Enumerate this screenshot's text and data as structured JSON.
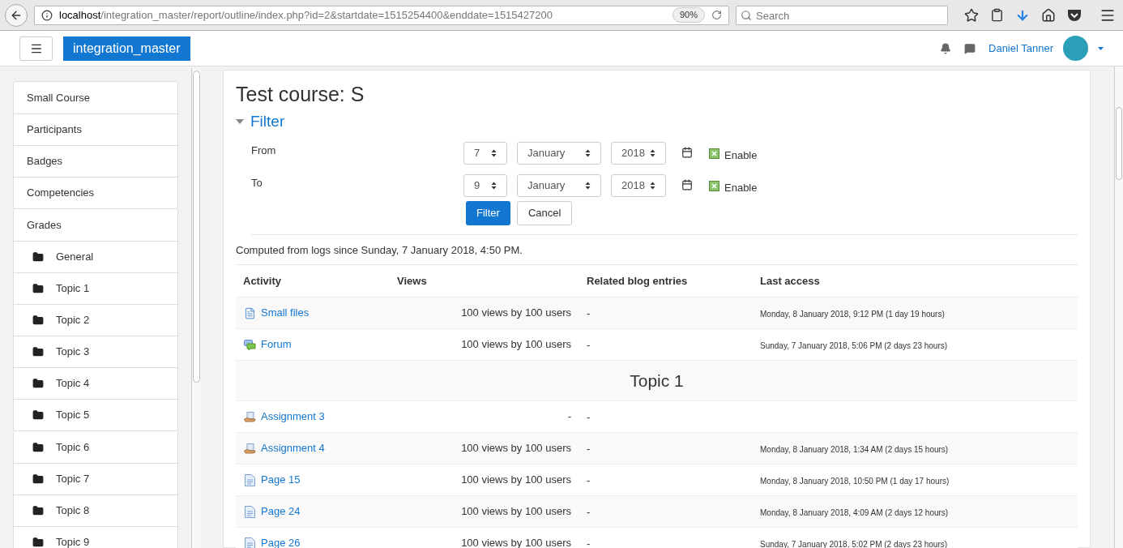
{
  "browser": {
    "url_host": "localhost",
    "url_path": "/integration_master/report/outline/index.php?id=2&startdate=1515254400&enddate=1515427200",
    "zoom": "90%",
    "search_placeholder": "Search"
  },
  "navbar": {
    "site_name": "integration_master",
    "user_name": "Daniel Tanner"
  },
  "sidebar": {
    "groups": [
      [
        {
          "label": "Small Course",
          "kind": "link"
        },
        {
          "label": "Participants",
          "kind": "link"
        },
        {
          "label": "Badges",
          "kind": "link"
        },
        {
          "label": "Competencies",
          "kind": "link"
        }
      ],
      [
        {
          "label": "Grades",
          "kind": "link"
        },
        {
          "label": "General",
          "kind": "folder"
        },
        {
          "label": "Topic 1",
          "kind": "folder"
        },
        {
          "label": "Topic 2",
          "kind": "folder"
        },
        {
          "label": "Topic 3",
          "kind": "folder"
        },
        {
          "label": "Topic 4",
          "kind": "folder"
        },
        {
          "label": "Topic 5",
          "kind": "folder"
        }
      ],
      [
        {
          "label": "Topic 6",
          "kind": "folder"
        },
        {
          "label": "Topic 7",
          "kind": "folder"
        },
        {
          "label": "Topic 8",
          "kind": "folder"
        },
        {
          "label": "Topic 9",
          "kind": "folder"
        }
      ]
    ]
  },
  "page_title": "Test course: S",
  "filter": {
    "title": "Filter",
    "expanded": true,
    "rows": [
      {
        "label": "From",
        "day": "7",
        "month": "January",
        "year": "2018",
        "enable_label": "Enable",
        "checked": true
      },
      {
        "label": "To",
        "day": "9",
        "month": "January",
        "year": "2018",
        "enable_label": "Enable",
        "checked": true
      }
    ],
    "buttons": [
      "Filter",
      "Cancel"
    ]
  },
  "computed_note": "Computed from logs since Sunday, 7 January 2018, 4:50 PM.",
  "table": {
    "columns": [
      "Activity",
      "Views",
      "Related blog entries",
      "Last access"
    ],
    "rows": [
      {
        "kind": "file",
        "name": "Small files",
        "views": "100 views by 100 users",
        "blog": "-",
        "last_access": "Monday, 8 January 2018, 9:12 PM (1 day 19 hours)"
      },
      {
        "kind": "forum",
        "name": "Forum",
        "views": "100 views by 100 users",
        "blog": "-",
        "last_access": "Sunday, 7 January 2018, 5:06 PM (2 days 23 hours)"
      },
      {
        "kind": "section",
        "name": "Topic 1"
      },
      {
        "kind": "assign",
        "name": "Assignment 3",
        "views": "-",
        "blog": "-"
      },
      {
        "kind": "assign",
        "name": "Assignment 4",
        "views": "100 views by 100 users",
        "blog": "-",
        "last_access": "Monday, 8 January 2018, 1:34 AM (2 days 15 hours)"
      },
      {
        "kind": "page",
        "name": "Page 15",
        "views": "100 views by 100 users",
        "blog": "-",
        "last_access": "Monday, 8 January 2018, 10:50 PM (1 day 17 hours)"
      },
      {
        "kind": "page",
        "name": "Page 24",
        "views": "100 views by 100 users",
        "blog": "-",
        "last_access": "Monday, 8 January 2018, 4:09 AM (2 days 12 hours)"
      },
      {
        "kind": "page",
        "name": "Page 26",
        "views": "100 views by 100 users",
        "blog": "-",
        "last_access": "Sunday, 7 January 2018, 5:02 PM (2 days 23 hours)"
      }
    ]
  }
}
